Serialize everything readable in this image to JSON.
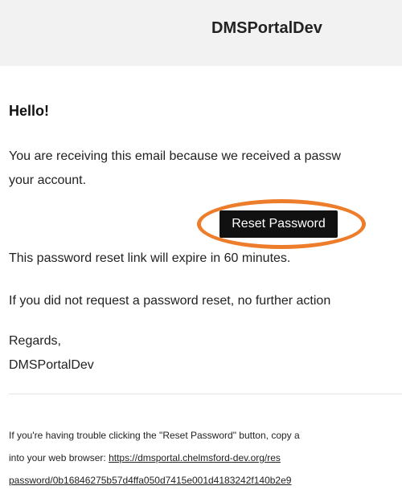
{
  "header": {
    "title": "DMSPortalDev"
  },
  "email": {
    "greeting": "Hello!",
    "intro_line1": "You are receiving this email because we received a passw",
    "intro_line2": "your account.",
    "button_label": "Reset Password",
    "expire_text": "This password reset link will expire in 60 minutes.",
    "no_action_text": "If you did not request a password reset, no further action",
    "regards": "Regards,",
    "signature": "DMSPortalDev"
  },
  "footer": {
    "line1": "If you're having trouble clicking the \"Reset Password\" button, copy a",
    "line2_prefix": "into your web browser: ",
    "link_part1": "https://dmsportal.chelmsford-dev.org/res",
    "link_part2": "password/0b16846275b57d4ffa050d7415e001d4183242f140b2e9"
  },
  "colors": {
    "highlight": "#ee7d2b",
    "button_bg": "#111111",
    "header_bg": "#f2f2f2"
  }
}
